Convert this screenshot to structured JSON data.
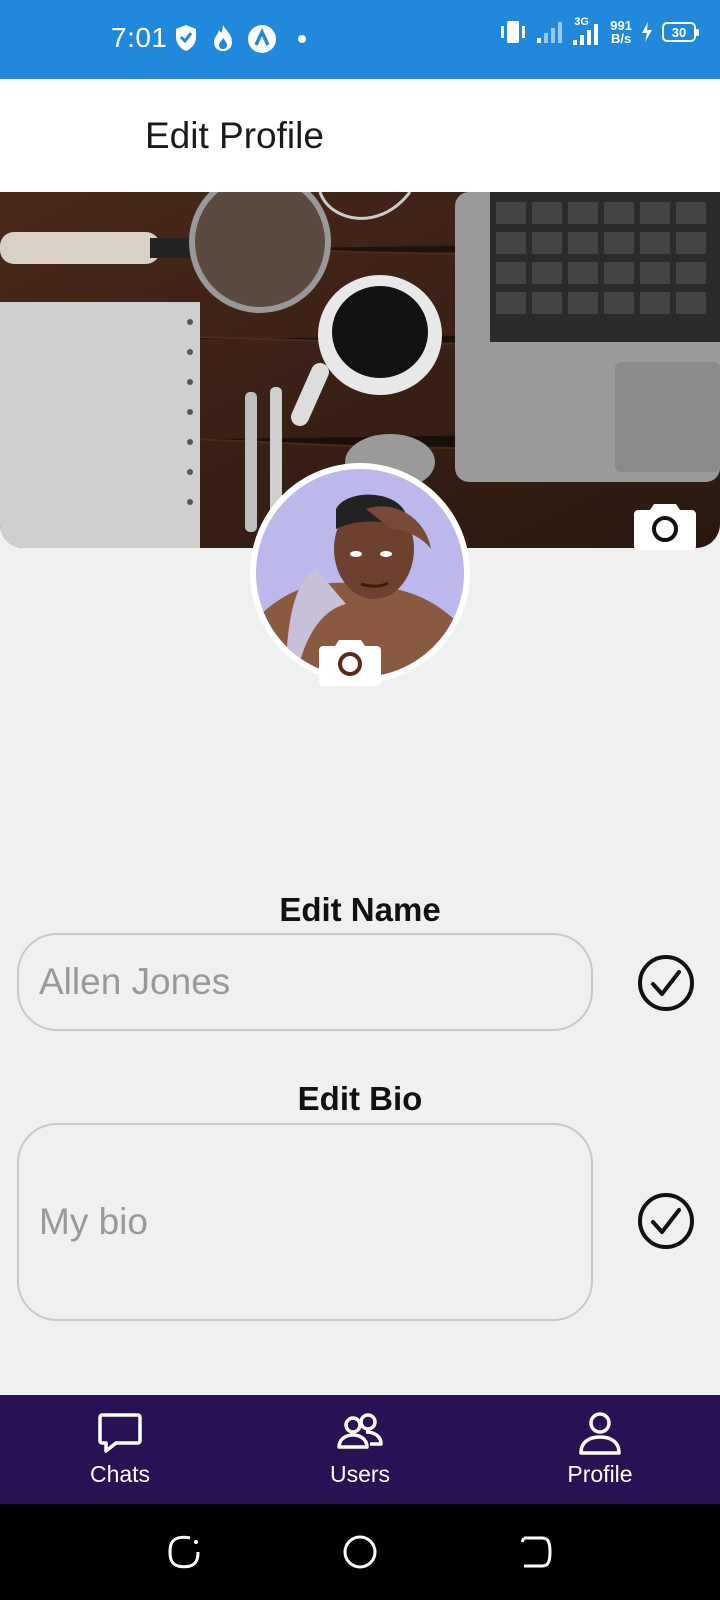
{
  "status_bar": {
    "time": "7:01",
    "net_speed_value": "991",
    "net_speed_unit": "B/s",
    "network_type": "3G",
    "battery": "30",
    "left_icons": [
      "shield-icon",
      "flame-icon",
      "app-a-icon",
      "dot-icon"
    ],
    "right_icons": [
      "vibrate-icon",
      "signal-icon",
      "signal-3g-icon",
      "charging-icon",
      "battery-icon"
    ]
  },
  "header": {
    "title": "Edit Profile"
  },
  "profile": {
    "cover_icon": "camera-icon",
    "avatar_icon": "camera-icon"
  },
  "form": {
    "name_label": "Edit Name",
    "name_value": "Allen Jones",
    "bio_label": "Edit Bio",
    "bio_value": "My bio",
    "confirm_icon": "check-circle-icon"
  },
  "bottom_nav": {
    "items": [
      {
        "label": "Chats",
        "icon": "chat-bubble-icon"
      },
      {
        "label": "Users",
        "icon": "users-icon"
      },
      {
        "label": "Profile",
        "icon": "user-icon"
      }
    ]
  },
  "system_nav": {
    "icons": [
      "recents-icon",
      "home-icon",
      "back-icon"
    ]
  },
  "colors": {
    "status_bar": "#2089dc",
    "bottom_nav": "#2a1154",
    "background": "#f0f0f0"
  }
}
